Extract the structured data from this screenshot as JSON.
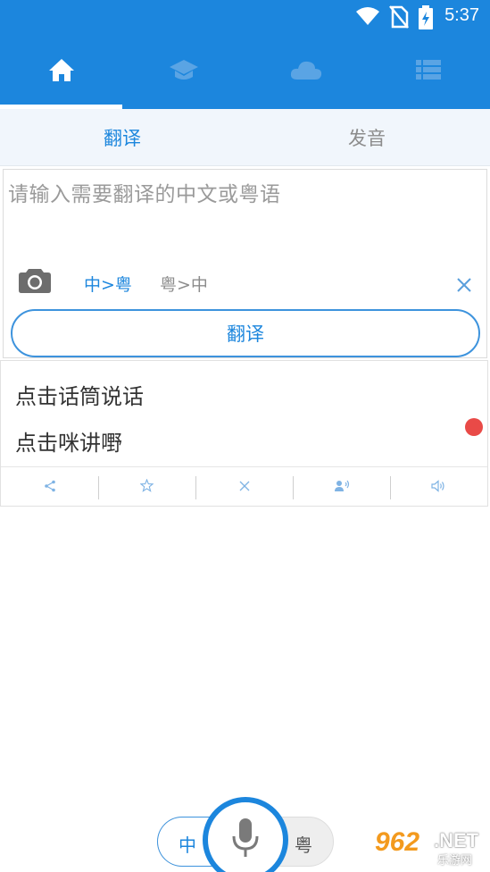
{
  "status_bar": {
    "time": "5:37",
    "icons": [
      "wifi-icon",
      "no-sim-icon",
      "battery-charging-icon"
    ]
  },
  "nav_tabs": [
    {
      "icon": "home-icon",
      "active": true
    },
    {
      "icon": "graduation-cap-icon",
      "active": false
    },
    {
      "icon": "cloud-icon",
      "active": false
    },
    {
      "icon": "list-icon",
      "active": false
    }
  ],
  "sub_tabs": {
    "translate": "翻译",
    "pronounce": "发音"
  },
  "input": {
    "placeholder": "请输入需要翻译的中文或粤语",
    "direction_zh_to_yue": "中>粤",
    "direction_yue_to_zh": "粤>中",
    "translate_button": "翻译"
  },
  "result": {
    "source_text": "点击话筒说话",
    "translated_text": "点击咪讲嘢",
    "actions": [
      "share-icon",
      "star-icon",
      "close-icon",
      "speaker-person-icon",
      "volume-icon"
    ]
  },
  "lang_switch": {
    "left": "中",
    "right": "粤"
  },
  "watermark": {
    "number": "962",
    "suffix": ".NET",
    "site": "乐游网"
  },
  "colors": {
    "primary": "#1c86dd",
    "subtab_bg": "#f1f6fc",
    "record_dot": "#e94a47",
    "inactive_text": "#8c8c8c"
  }
}
